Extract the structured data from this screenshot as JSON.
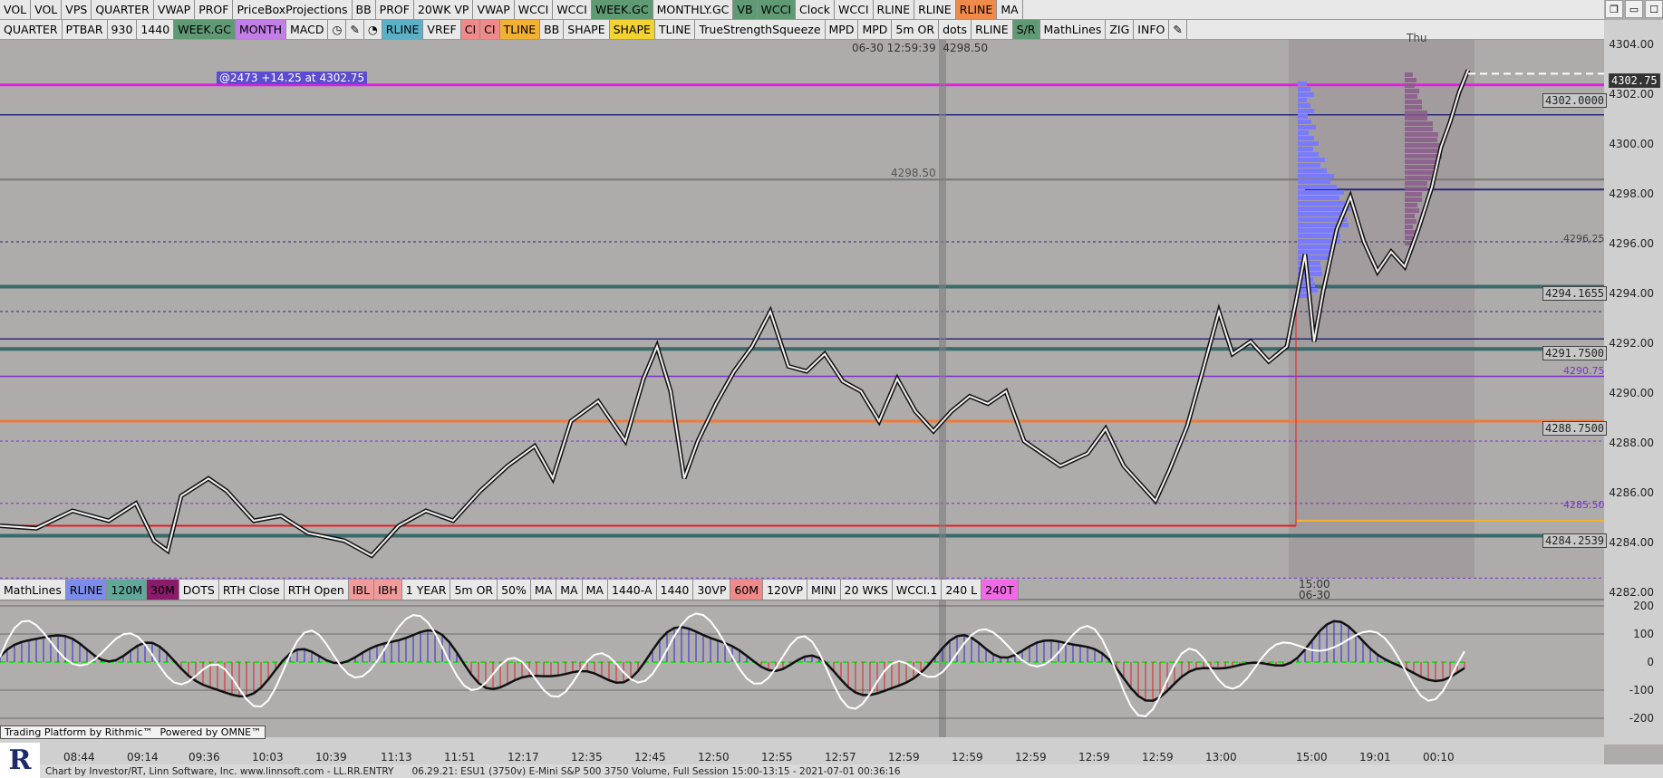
{
  "toolbar_top": [
    {
      "label": "VOL",
      "bg": "#e8e8e8"
    },
    {
      "label": "VOL",
      "bg": "#e8e8e8"
    },
    {
      "label": "VPS",
      "bg": "#e8e8e8"
    },
    {
      "label": "QUARTER",
      "bg": "#e8e8e8"
    },
    {
      "label": "VWAP",
      "bg": "#e8e8e8"
    },
    {
      "label": "PROF",
      "bg": "#e8e8e8"
    },
    {
      "label": "PriceBoxProjections",
      "bg": "#e8e8e8"
    },
    {
      "label": "BB",
      "bg": "#e8e8e8"
    },
    {
      "label": "PROF",
      "bg": "#e8e8e8"
    },
    {
      "label": "20WK VP",
      "bg": "#e8e8e8"
    },
    {
      "label": "VWAP",
      "bg": "#e8e8e8"
    },
    {
      "label": "WCCI",
      "bg": "#e8e8e8"
    },
    {
      "label": "WCCI",
      "bg": "#e8e8e8"
    },
    {
      "label": "WEEK.GC",
      "bg": "#5f9a74"
    },
    {
      "label": "MONTHLY.GC",
      "bg": "#e8e8e8"
    },
    {
      "label": "VB",
      "bg": "#5f9a74"
    },
    {
      "label": "WCCI",
      "bg": "#5f9a74"
    },
    {
      "label": "Clock",
      "bg": "#e8e8e8"
    },
    {
      "label": "WCCI",
      "bg": "#e8e8e8"
    },
    {
      "label": "RLINE",
      "bg": "#e8e8e8"
    },
    {
      "label": "RLINE",
      "bg": "#e8e8e8"
    },
    {
      "label": "RLINE",
      "bg": "#f08a4b"
    },
    {
      "label": "MA",
      "bg": "#e8e8e8"
    }
  ],
  "toolbar_second": [
    {
      "label": "QUARTER",
      "bg": "#e8e8e8"
    },
    {
      "label": "PTBAR",
      "bg": "#e8e8e8"
    },
    {
      "label": "930",
      "bg": "#e8e8e8"
    },
    {
      "label": "1440",
      "bg": "#e8e8e8"
    },
    {
      "label": "WEEK.GC",
      "bg": "#5f9a74"
    },
    {
      "label": "MONTH",
      "bg": "#c27ee6"
    },
    {
      "label": "MACD",
      "bg": "#e8e8e8"
    },
    {
      "label": "clock-icon",
      "bg": "#e8e8e8",
      "icon": "◷"
    },
    {
      "label": "pencil-icon",
      "bg": "#e8e8e8",
      "icon": "✎"
    },
    {
      "label": "chart-icon",
      "bg": "#e8e8e8",
      "icon": "◔"
    },
    {
      "label": "RLINE",
      "bg": "#5bb0c8"
    },
    {
      "label": "VREF",
      "bg": "#e8e8e8"
    },
    {
      "label": "CI",
      "bg": "#f08a8a"
    },
    {
      "label": "CI",
      "bg": "#f08a8a"
    },
    {
      "label": "TLINE",
      "bg": "#f2b133"
    },
    {
      "label": "BB",
      "bg": "#e8e8e8"
    },
    {
      "label": "SHAPE",
      "bg": "#e8e8e8"
    },
    {
      "label": "SHAPE",
      "bg": "#f2d333"
    },
    {
      "label": "TLINE",
      "bg": "#e8e8e8"
    },
    {
      "label": "TrueStrengthSqueeze",
      "bg": "#e8e8e8"
    },
    {
      "label": "MPD",
      "bg": "#e8e8e8"
    },
    {
      "label": "MPD",
      "bg": "#e8e8e8"
    },
    {
      "label": "5m OR",
      "bg": "#e8e8e8"
    },
    {
      "label": "dots",
      "bg": "#e8e8e8"
    },
    {
      "label": "RLINE",
      "bg": "#e8e8e8"
    },
    {
      "label": "S/R",
      "bg": "#5f9a74"
    },
    {
      "label": "MathLines",
      "bg": "#e8e8e8"
    },
    {
      "label": "ZIG",
      "bg": "#e8e8e8"
    },
    {
      "label": "INFO",
      "bg": "#e8e8e8"
    },
    {
      "label": "pencil-icon",
      "bg": "#e8e8e8",
      "icon": "✎"
    }
  ],
  "toolbar_bottom": [
    {
      "label": "MathLines",
      "bg": "#e8e8e8"
    },
    {
      "label": "RLINE",
      "bg": "#7b8de8"
    },
    {
      "label": "120M",
      "bg": "#5fa89a"
    },
    {
      "label": "30M",
      "bg": "#8a1a6a"
    },
    {
      "label": "DOTS",
      "bg": "#e8e8e8"
    },
    {
      "label": "RTH Close",
      "bg": "#e8e8e8"
    },
    {
      "label": "RTH Open",
      "bg": "#e8e8e8"
    },
    {
      "label": "IBL",
      "bg": "#f09a9a"
    },
    {
      "label": "IBH",
      "bg": "#f09a9a"
    },
    {
      "label": "1 YEAR",
      "bg": "#e8e8e8"
    },
    {
      "label": "5m OR",
      "bg": "#e8e8e8"
    },
    {
      "label": "50%",
      "bg": "#e8e8e8"
    },
    {
      "label": "MA",
      "bg": "#e8e8e8"
    },
    {
      "label": "MA",
      "bg": "#e8e8e8"
    },
    {
      "label": "MA",
      "bg": "#e8e8e8"
    },
    {
      "label": "1440-A",
      "bg": "#e8e8e8"
    },
    {
      "label": "1440",
      "bg": "#e8e8e8"
    },
    {
      "label": "30VP",
      "bg": "#e8e8e8"
    },
    {
      "label": "60M",
      "bg": "#f08a8a"
    },
    {
      "label": "120VP",
      "bg": "#e8e8e8"
    },
    {
      "label": "MINI",
      "bg": "#e8e8e8"
    },
    {
      "label": "20 WKS",
      "bg": "#e8e8e8"
    },
    {
      "label": "WCCI.1",
      "bg": "#e8e8e8"
    },
    {
      "label": "240 L",
      "bg": "#e8e8e8"
    },
    {
      "label": "240T",
      "bg": "#f06ae6"
    }
  ],
  "window_controls": [
    "❐",
    "▭",
    "☐"
  ],
  "cursor_readout": "06-30 12:59:39",
  "cursor_price": "4298.50",
  "trade_tag": "@2473  +14.25 at 4302.75",
  "line_label_left": "4298.50",
  "day_label": "Thu",
  "session_label_time": "15:00",
  "session_label_date": "06-30",
  "price_axis": [
    "4304.00",
    "4302.00",
    "4300.00",
    "4298.00",
    "4296.00",
    "4294.00",
    "4292.00",
    "4290.00",
    "4288.00",
    "4286.00",
    "4284.00",
    "4282.00"
  ],
  "price_tags": [
    {
      "text": "4302.75",
      "style": "last"
    },
    {
      "text": "4302.0000",
      "style": "box"
    },
    {
      "text": "4296.25",
      "style": "plain"
    },
    {
      "text": "4294.1655",
      "style": "box"
    },
    {
      "text": "4291.7500",
      "style": "box"
    },
    {
      "text": "4290.75",
      "style": "purple"
    },
    {
      "text": "4288.7500",
      "style": "box"
    },
    {
      "text": "4285.50",
      "style": "purple"
    },
    {
      "text": "4284.2539",
      "style": "box"
    }
  ],
  "osc_axis": [
    "200",
    "100",
    "0",
    "-100",
    "-200"
  ],
  "time_axis": [
    "08:44",
    "09:14",
    "09:36",
    "10:03",
    "10:39",
    "11:13",
    "11:51",
    "12:17",
    "12:35",
    "12:45",
    "12:50",
    "12:55",
    "12:57",
    "12:59",
    "12:59",
    "12:59",
    "12:59",
    "12:59",
    "13:00",
    "15:00",
    "19:01",
    "00:10"
  ],
  "rithmic_text": "Trading Platform by Rithmic™",
  "omne_text": "Powered by OMNE™",
  "logo_letter": "R",
  "status_left": "Chart by Investor/RT, Linn Software, Inc. www.linnsoft.com - LL.RR.ENTRY",
  "status_right": "06.29.21: ESU1 (3750v) E-Mini S&P 500 3750 Volume, Full Session 15:00-13:15 - 2021-07-01 00:36:16",
  "colors": {
    "magenta": "#e020e0",
    "orange": "#f07a3a",
    "navy": "#2a2a7a",
    "purple": "#7a30d0",
    "red": "#e02020",
    "teal": "#3a6a6a",
    "profile_blue": "#7a7aff",
    "profile_purple": "#8a5a8a"
  }
}
